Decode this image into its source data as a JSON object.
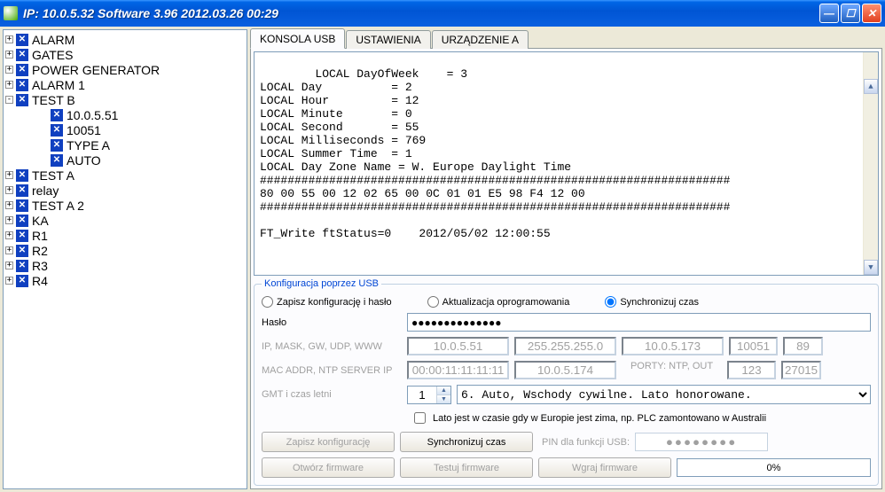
{
  "window": {
    "title": "IP: 10.0.5.32   Software 3.96  2012.03.26  00:29"
  },
  "tree": {
    "nodes": [
      {
        "expander": "+",
        "label": "ALARM",
        "depth": 1
      },
      {
        "expander": "+",
        "label": "GATES",
        "depth": 1
      },
      {
        "expander": "+",
        "label": "POWER GENERATOR",
        "depth": 1
      },
      {
        "expander": "+",
        "label": "ALARM 1",
        "depth": 1
      },
      {
        "expander": "-",
        "label": "TEST B",
        "depth": 1
      },
      {
        "expander": "",
        "label": "10.0.5.51",
        "depth": 2
      },
      {
        "expander": "",
        "label": "10051",
        "depth": 2
      },
      {
        "expander": "",
        "label": "TYPE A",
        "depth": 2
      },
      {
        "expander": "",
        "label": "AUTO",
        "depth": 2
      },
      {
        "expander": "+",
        "label": "TEST A",
        "depth": 1
      },
      {
        "expander": "+",
        "label": "relay",
        "depth": 1
      },
      {
        "expander": "+",
        "label": "TEST A 2",
        "depth": 1
      },
      {
        "expander": "+",
        "label": "KA",
        "depth": 1
      },
      {
        "expander": "+",
        "label": "R1",
        "depth": 1
      },
      {
        "expander": "+",
        "label": "R2",
        "depth": 1
      },
      {
        "expander": "+",
        "label": "R3",
        "depth": 1
      },
      {
        "expander": "+",
        "label": "R4",
        "depth": 1
      }
    ]
  },
  "tabs": {
    "0": {
      "label": "KONSOLA USB"
    },
    "1": {
      "label": "USTAWIENIA"
    },
    "2": {
      "label": "URZĄDZENIE A"
    }
  },
  "console": {
    "text": "LOCAL DayOfWeek    = 3\nLOCAL Day          = 2\nLOCAL Hour         = 12\nLOCAL Minute       = 0\nLOCAL Second       = 55\nLOCAL Milliseconds = 769\nLOCAL Summer Time  = 1\nLOCAL Day Zone Name = W. Europe Daylight Time\n####################################################################\n80 00 55 00 12 02 65 00 0C 01 01 E5 98 F4 12 00\n####################################################################\n\nFT_Write ftStatus=0    2012/05/02 12:00:55"
  },
  "usb_config": {
    "legend": "Konfiguracja poprzez USB",
    "radios": {
      "save": "Zapisz konfigurację i hasło",
      "update": "Aktualizacja oprogramowania",
      "sync": "Synchronizuj czas"
    },
    "labels": {
      "password": "Hasło",
      "ip_row": "IP, MASK, GW, UDP, WWW",
      "mac_row": "MAC ADDR, NTP SERVER IP",
      "ports_label": "PORTY: NTP, OUT",
      "gmt_row": "GMT i czas letni",
      "checkbox": "Lato jest w czasie gdy w Europie jest zima, np. PLC zamontowano w Australii",
      "pin_label": "PIN dla funkcji USB:"
    },
    "fields": {
      "password_mask": "●●●●●●●●●●●●●●",
      "ip": "10.0.5.51",
      "mask": "255.255.255.0",
      "gw": "10.0.5.173",
      "udp": "10051",
      "www": "89",
      "mac": "00:00:11:11:11:11",
      "ntp": "10.0.5.174",
      "port_ntp": "123",
      "port_out": "27015",
      "gmt": "1",
      "tz_option": "6. Auto, Wschody cywilne. Lato honorowane.",
      "pin_mask": "●●●●●●●●",
      "progress": "0%"
    },
    "buttons": {
      "save_cfg": "Zapisz konfigurację",
      "sync_time": "Synchronizuj czas",
      "open_fw": "Otwórz firmware",
      "test_fw": "Testuj firmware",
      "upload_fw": "Wgraj firmware"
    }
  }
}
